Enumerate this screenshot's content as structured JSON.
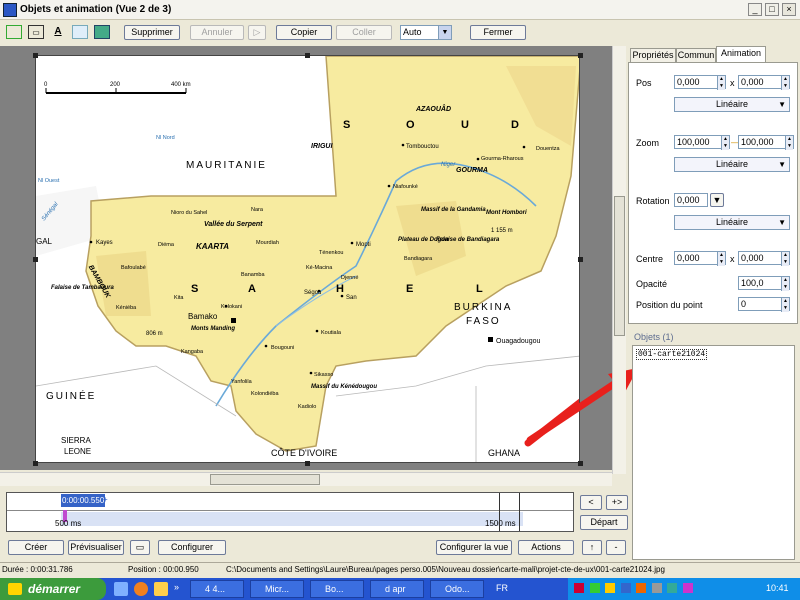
{
  "window": {
    "title": "Objets et animation  (Vue 2 de 3)",
    "controls": [
      "_",
      "□",
      "×"
    ]
  },
  "toolbar": {
    "buttons": {
      "supprimer": "Supprimer",
      "annuler": "Annuler",
      "copier": "Copier",
      "coller": "Coller",
      "fermer": "Fermer",
      "arrows": "▷"
    },
    "zoom_value": "Auto"
  },
  "tabs": [
    "Propriétés",
    "Commun",
    "Animation"
  ],
  "animation_panel": {
    "pos_label": "Pos",
    "pos_x": "0,000",
    "pos_y": "0,000",
    "x_sep": "x",
    "pos_mode": "Linéaire",
    "zoom_label": "Zoom",
    "zoom_x": "100,000",
    "zoom_y": "100,000",
    "zoom_sep": "—",
    "zoom_mode": "Linéaire",
    "rotation_label": "Rotation",
    "rotation_value": "0,000",
    "rotation_mode": "Linéaire",
    "centre_label": "Centre",
    "centre_x": "0,000",
    "centre_y": "0,000",
    "centre_sep": "x",
    "opacite_label": "Opacité",
    "opacite_value": "100,0",
    "position_point_label": "Position du point",
    "position_point_value": "0"
  },
  "objects": {
    "header": "Objets (1)",
    "items": [
      "001-carte21024"
    ]
  },
  "timeline": {
    "start_time": "0:00:00.550",
    "plus": "+",
    "left_marker": "500 ms",
    "right_marker": "1500 ms",
    "nav_back": "<",
    "nav_fwd": "+>",
    "depart": "Départ"
  },
  "bottom_buttons": {
    "creer": "Créer",
    "previsualiser": "Prévisualiser",
    "configurer": "Configurer",
    "configurer_la_vue": "Configurer la vue",
    "actions": "Actions",
    "up": "↑",
    "down": "-"
  },
  "status": {
    "duree": "Durée : 0:00:31.786",
    "position": "Position : 00:00.950",
    "path": "C:\\Documents and Settings\\Laure\\Bureau\\pages perso.005\\Nouveau dossier\\carte-mali\\projet-cte-de-ux\\001-carte21024.jpg"
  },
  "taskbar": {
    "start": "démarrer",
    "tasks": [
      "4 4...",
      "Micr...",
      "Bo...",
      "d apr",
      "Odo...",
      "FR"
    ],
    "clock": "10:41"
  },
  "map": {
    "scale_ticks": [
      "0",
      "200",
      "400 km"
    ],
    "labels": {
      "mauritanie": "MAURITANIE",
      "irigui": "IRIGUI",
      "azaouad": "AZAOUÂD",
      "s": "S",
      "o": "O",
      "u": "U",
      "d": "D",
      "tombouctou": "Tombouctou",
      "gourma_rharous": "Gourma-Rharous",
      "douentza": "Douentza",
      "gourma": "GOURMA",
      "niafounke": "Niafounké",
      "niger": "Niger",
      "massif_gandamia": "Massif de la Gandamia",
      "mont_hombori": "Mont Hombori",
      "hombori_alt": "1 155 m",
      "nioro": "Nioro du Sahel",
      "nara": "Nara",
      "vallee_serpent": "Vallée du Serpent",
      "kayes": "Kayes",
      "diema": "Diéma",
      "kaarta": "KAARTA",
      "mourdiah": "Mourdiah",
      "mopti": "Mopti",
      "bandiagara": "Bandiagara",
      "plateau_dogon": "Plateau de Dogon",
      "falaise_bandiagara": "Falaise de Bandiagara",
      "tenenkou": "Ténenkou",
      "bambouk": "BAMBOUK",
      "bafoulabe": "Bafoulabé",
      "ke_macina": "Ké-Macina",
      "djenne": "Djenné",
      "kita": "Kita",
      "banamba": "Banamba",
      "sahel_s": "S",
      "sahel_a": "A",
      "sahel_h": "H",
      "sahel_e": "E",
      "sahel_l": "L",
      "kenieba": "Kéniéba",
      "falaise_tambaoura": "Falaise de Tambaoura",
      "kolokani": "Kolokani",
      "segou": "Ségou",
      "san": "San",
      "bamako": "Bamako",
      "monts_manding": "Monts Manding",
      "alt_806": "806 m",
      "kangaba": "Kangaba",
      "koutiala": "Koutiala",
      "bougouni": "Bougouni",
      "yanfolila": "Yanfolila",
      "kolondieba": "Kolondiéba",
      "sikasso": "Sikasso",
      "massif_kenedougou": "Massif du Kénédougou",
      "kadiolo": "Kadiolo",
      "burkina": "BURKINA",
      "faso": "FASO",
      "ouagadougou": "Ouagadougou",
      "guinee": "GUINÉE",
      "sierra": "SIERRA",
      "leone": "LEONE",
      "cote_ivoire": "CÔTE D'IVOIRE",
      "ghana": "GHANA",
      "gal": "GAL",
      "senegal": "Sénégal",
      "nl_ouest": "Nl Ouest",
      "nl_nord": "Nl Nord"
    }
  },
  "colors": {
    "mali_fill": "#f7eba0",
    "mali_border": "#b8a060",
    "red_arrow": "#e8201c",
    "taskbar": "#2454d0",
    "start_green": "#3c9b3c"
  }
}
